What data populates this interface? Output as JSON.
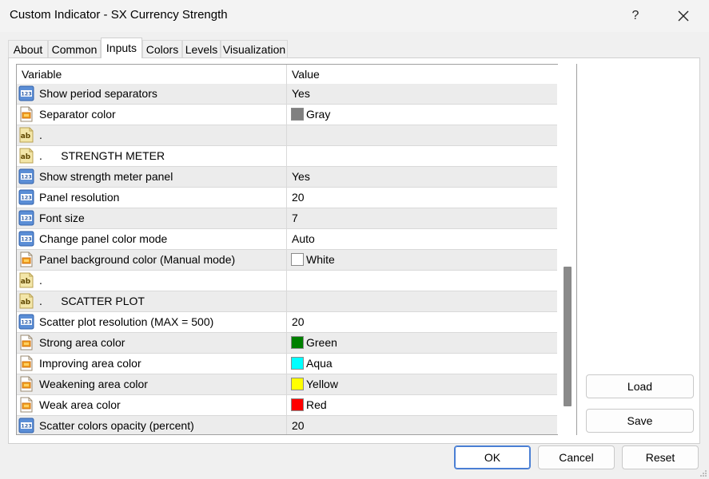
{
  "window": {
    "title": "Custom Indicator - SX Currency Strength",
    "help_label": "?",
    "close_label": "✕"
  },
  "tabs": [
    "About",
    "Common",
    "Inputs",
    "Colors",
    "Levels",
    "Visualization"
  ],
  "active_tab": "Inputs",
  "grid": {
    "col_variable": "Variable",
    "col_value": "Value",
    "rows": [
      {
        "type": "int",
        "label": "Show period separators",
        "value": "Yes"
      },
      {
        "type": "color",
        "label": "Separator color",
        "value": "Gray",
        "swatch": "#808080"
      },
      {
        "type": "string",
        "label": ".",
        "value": ""
      },
      {
        "type": "string",
        "label": ".      STRENGTH METER",
        "value": ""
      },
      {
        "type": "int",
        "label": "Show strength meter panel",
        "value": "Yes"
      },
      {
        "type": "int",
        "label": "Panel resolution",
        "value": "20"
      },
      {
        "type": "int",
        "label": "Font size",
        "value": "7"
      },
      {
        "type": "int",
        "label": "Change panel color mode",
        "value": "Auto"
      },
      {
        "type": "color",
        "label": "Panel background color (Manual mode)",
        "value": "White",
        "swatch": "#ffffff"
      },
      {
        "type": "string",
        "label": ".",
        "value": ""
      },
      {
        "type": "string",
        "label": ".      SCATTER PLOT",
        "value": ""
      },
      {
        "type": "int",
        "label": "Scatter plot resolution (MAX = 500)",
        "value": "20"
      },
      {
        "type": "color",
        "label": "Strong area color",
        "value": "Green",
        "swatch": "#008000"
      },
      {
        "type": "color",
        "label": "Improving area color",
        "value": "Aqua",
        "swatch": "#00ffff"
      },
      {
        "type": "color",
        "label": "Weakening area color",
        "value": "Yellow",
        "swatch": "#ffff00"
      },
      {
        "type": "color",
        "label": "Weak area color",
        "value": "Red",
        "swatch": "#ff0000"
      },
      {
        "type": "int",
        "label": "Scatter colors opacity (percent)",
        "value": "20"
      }
    ]
  },
  "side_buttons": {
    "load": "Load",
    "save": "Save"
  },
  "footer_buttons": {
    "ok": "OK",
    "cancel": "Cancel",
    "reset": "Reset"
  },
  "icons": {
    "int": "numeric-123-icon",
    "color": "color-palette-icon",
    "string": "text-ab-icon"
  }
}
